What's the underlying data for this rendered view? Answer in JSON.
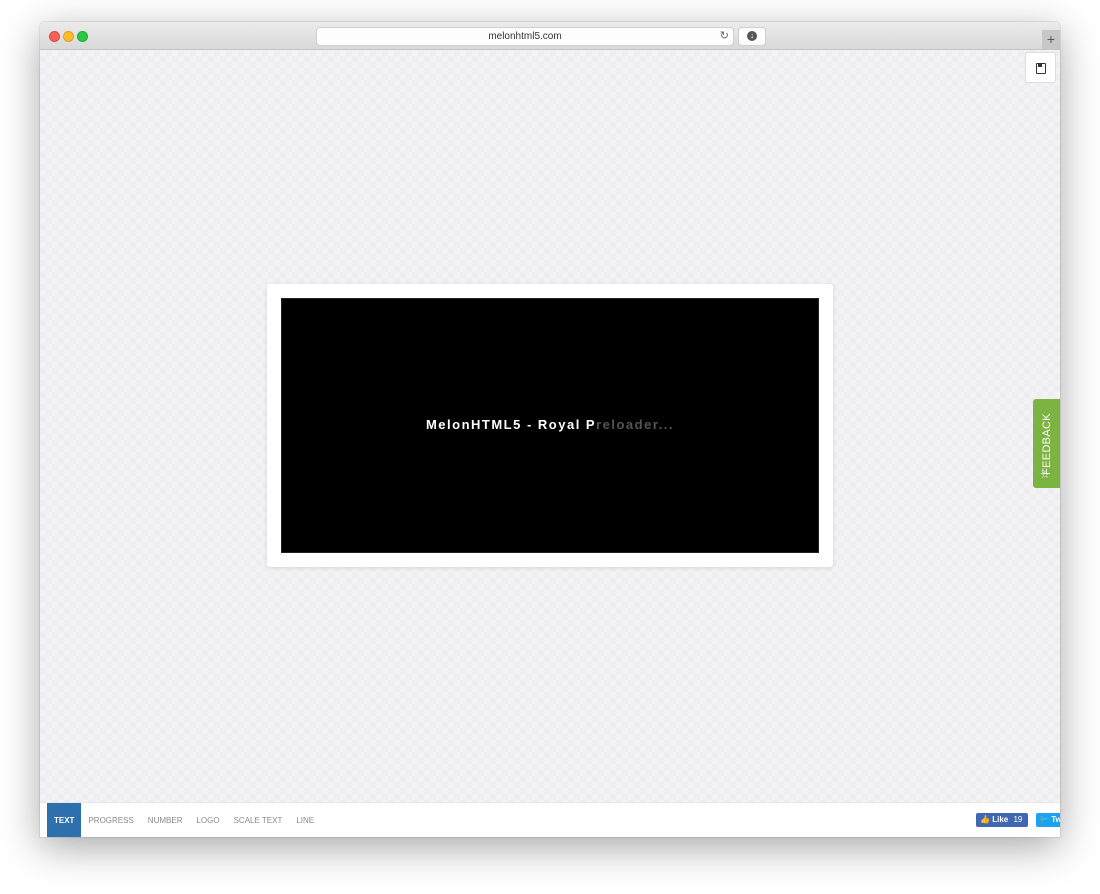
{
  "browser": {
    "url": "melonhtml5.com",
    "reload_icon": "reload-icon",
    "download_icon": "download-icon",
    "new_tab_label": "+"
  },
  "preview": {
    "text_lit": "MelonHTML5 - Royal P",
    "text_dim": "reloader..."
  },
  "save_icon": "floppy-disk-icon",
  "feedback": {
    "label": "FEEDBACK",
    "icon": "star-icon",
    "color": "#7cb342"
  },
  "bottom_tabs": [
    {
      "label": "TEXT",
      "active": true
    },
    {
      "label": "PROGRESS",
      "active": false
    },
    {
      "label": "NUMBER",
      "active": false
    },
    {
      "label": "LOGO",
      "active": false
    },
    {
      "label": "SCALE TEXT",
      "active": false
    },
    {
      "label": "LINE",
      "active": false
    }
  ],
  "social": {
    "fb_like_label": "Like",
    "fb_like_count": "19",
    "tweet_label": "Tweet"
  },
  "colors": {
    "active_tab": "#2e6fae",
    "facebook": "#4267b2",
    "twitter": "#1da1f2"
  }
}
